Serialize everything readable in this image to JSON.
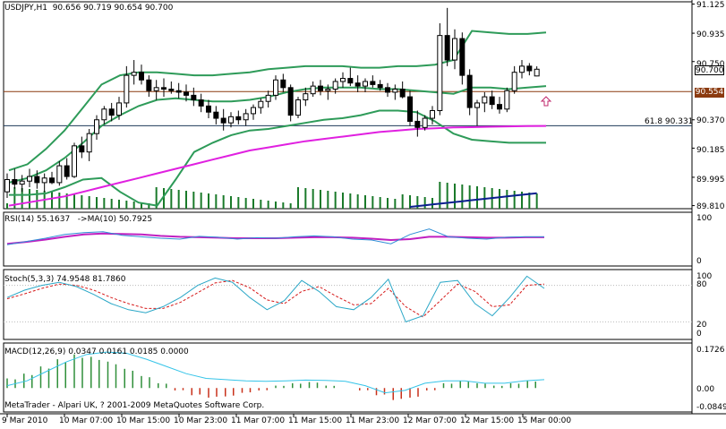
{
  "main": {
    "title": "USDJPY,H1",
    "ohlc": [
      "90.656",
      "90.719",
      "90.654",
      "90.700"
    ],
    "price_ticks": [
      "91.125",
      "90.935",
      "90.750",
      "90.370",
      "90.185",
      "89.995",
      "89.810"
    ],
    "current_price_tag": "90.700",
    "hline_price_tag": "90.554",
    "fib_label": "61.8 90.331",
    "price_range": [
      89.79,
      91.14
    ],
    "colors": {
      "bollinger": "#2e9b59",
      "ma": "#e020e0",
      "hline": "#8b3a0f",
      "fib": "#1f3a5a",
      "volume": "#1a7a2a",
      "obv": "#0b1f8f",
      "arrow": "#c0286c"
    }
  },
  "rsi": {
    "title": "RSI(14) 55.1637",
    "ma_title": "->MA(10) 50.7925",
    "ticks": [
      "100",
      "0"
    ],
    "colors": {
      "rsi": "#2f8fd6",
      "ma": "#c020c0"
    }
  },
  "stoch": {
    "title": "Stoch(5,3,3) 74.9548 81.7860",
    "ticks": [
      "100",
      "80",
      "20",
      "0"
    ],
    "colors": {
      "main": "#2aa7c7",
      "signal": "#d61a1a"
    }
  },
  "macd": {
    "title": "MACD(12,26,9) 0.0347 0.0161 0.0185 0.0000",
    "ticks": [
      "0.1726",
      "0.00",
      "-0.0849"
    ],
    "copyright": "MetaTrader - Alpari UK, ? 2001-2009 MetaQuotes Software Corp.",
    "colors": {
      "line": "#35c4e8",
      "pos": "#2f8f3a",
      "neg": "#c8301a"
    }
  },
  "time_axis": [
    "9 Mar 2010",
    "10 Mar 07:00",
    "10 Mar 15:00",
    "10 Mar 23:00",
    "11 Mar 07:00",
    "11 Mar 15:00",
    "11 Mar 23:00",
    "12 Mar 07:00",
    "12 Mar 15:00",
    "15 Mar 00:00"
  ],
  "chart_data": {
    "type": "line",
    "symbol": "USDJPY",
    "timeframe": "H1",
    "hlines": [
      90.554,
      90.331
    ],
    "candles_ohlc": [
      [
        89.9,
        90.02,
        89.86,
        89.98
      ],
      [
        89.98,
        90.05,
        89.92,
        89.95
      ],
      [
        89.95,
        90.01,
        89.9,
        89.97
      ],
      [
        89.97,
        90.05,
        89.93,
        90.0
      ],
      [
        90.0,
        90.04,
        89.92,
        89.96
      ],
      [
        89.96,
        90.02,
        89.9,
        89.99
      ],
      [
        89.99,
        90.03,
        89.95,
        89.96
      ],
      [
        89.96,
        90.1,
        89.94,
        90.07
      ],
      [
        90.07,
        90.12,
        89.98,
        90.0
      ],
      [
        90.0,
        90.22,
        89.99,
        90.2
      ],
      [
        90.2,
        90.26,
        90.12,
        90.16
      ],
      [
        90.16,
        90.31,
        90.1,
        90.28
      ],
      [
        90.28,
        90.4,
        90.24,
        90.37
      ],
      [
        90.37,
        90.46,
        90.34,
        90.44
      ],
      [
        90.44,
        90.48,
        90.36,
        90.4
      ],
      [
        90.4,
        90.52,
        90.37,
        90.48
      ],
      [
        90.48,
        90.72,
        90.45,
        90.66
      ],
      [
        90.66,
        90.76,
        90.6,
        90.68
      ],
      [
        90.68,
        90.73,
        90.6,
        90.63
      ],
      [
        90.63,
        90.66,
        90.52,
        90.56
      ],
      [
        90.56,
        90.63,
        90.5,
        90.58
      ],
      [
        90.58,
        90.64,
        90.52,
        90.57
      ],
      [
        90.57,
        90.62,
        90.54,
        90.56
      ],
      [
        90.56,
        90.61,
        90.51,
        90.55
      ],
      [
        90.55,
        90.6,
        90.49,
        90.53
      ],
      [
        90.53,
        90.58,
        90.46,
        90.5
      ],
      [
        90.5,
        90.54,
        90.42,
        90.46
      ],
      [
        90.46,
        90.5,
        90.38,
        90.42
      ],
      [
        90.42,
        90.46,
        90.34,
        90.38
      ],
      [
        90.38,
        90.44,
        90.3,
        90.35
      ],
      [
        90.35,
        90.42,
        90.32,
        90.39
      ],
      [
        90.39,
        90.43,
        90.34,
        90.37
      ],
      [
        90.37,
        90.44,
        90.33,
        90.41
      ],
      [
        90.41,
        90.47,
        90.37,
        90.45
      ],
      [
        90.45,
        90.51,
        90.41,
        90.49
      ],
      [
        90.49,
        90.56,
        90.45,
        90.53
      ],
      [
        90.53,
        90.66,
        90.5,
        90.63
      ],
      [
        90.63,
        90.67,
        90.55,
        90.58
      ],
      [
        90.58,
        90.6,
        90.36,
        90.4
      ],
      [
        90.4,
        90.52,
        90.38,
        90.5
      ],
      [
        90.5,
        90.58,
        90.46,
        90.54
      ],
      [
        90.54,
        90.62,
        90.52,
        90.59
      ],
      [
        90.59,
        90.63,
        90.53,
        90.56
      ],
      [
        90.56,
        90.6,
        90.5,
        90.57
      ],
      [
        90.57,
        90.64,
        90.54,
        90.62
      ],
      [
        90.62,
        90.68,
        90.58,
        90.64
      ],
      [
        90.64,
        90.71,
        90.59,
        90.61
      ],
      [
        90.61,
        90.66,
        90.55,
        90.59
      ],
      [
        90.59,
        90.64,
        90.55,
        90.62
      ],
      [
        90.62,
        90.66,
        90.58,
        90.6
      ],
      [
        90.6,
        90.63,
        90.56,
        90.58
      ],
      [
        90.58,
        90.61,
        90.52,
        90.55
      ],
      [
        90.55,
        90.6,
        90.5,
        90.57
      ],
      [
        90.57,
        90.62,
        90.51,
        90.52
      ],
      [
        90.52,
        90.56,
        90.33,
        90.36
      ],
      [
        90.36,
        90.43,
        90.26,
        90.32
      ],
      [
        90.32,
        90.4,
        90.3,
        90.38
      ],
      [
        90.38,
        90.46,
        90.34,
        90.43
      ],
      [
        90.43,
        91.0,
        90.4,
        90.92
      ],
      [
        90.92,
        91.1,
        90.72,
        90.76
      ],
      [
        90.76,
        90.96,
        90.7,
        90.9
      ],
      [
        90.9,
        90.94,
        90.6,
        90.66
      ],
      [
        90.66,
        90.7,
        90.4,
        90.45
      ],
      [
        90.45,
        90.5,
        90.33,
        90.48
      ],
      [
        90.48,
        90.55,
        90.42,
        90.52
      ],
      [
        90.52,
        90.56,
        90.44,
        90.47
      ],
      [
        90.47,
        90.52,
        90.41,
        90.44
      ],
      [
        90.44,
        90.58,
        90.42,
        90.56
      ],
      [
        90.56,
        90.72,
        90.54,
        90.68
      ],
      [
        90.68,
        90.76,
        90.64,
        90.72
      ],
      [
        90.72,
        90.74,
        90.66,
        90.69
      ],
      [
        90.656,
        90.719,
        90.654,
        90.7
      ]
    ],
    "ma_slow": [
      89.81,
      89.83,
      89.85,
      89.87,
      89.9,
      89.93,
      89.96,
      89.99,
      90.02,
      90.05,
      90.08,
      90.11,
      90.14,
      90.17,
      90.19,
      90.21,
      90.23,
      90.245,
      90.26,
      90.275,
      90.29,
      90.3,
      90.31,
      90.315,
      90.32,
      90.322,
      90.325,
      90.327,
      90.329,
      90.33
    ],
    "bb_upper": [
      90.04,
      90.08,
      90.18,
      90.3,
      90.45,
      90.6,
      90.66,
      90.68,
      90.68,
      90.67,
      90.66,
      90.66,
      90.67,
      90.68,
      90.7,
      90.71,
      90.72,
      90.72,
      90.72,
      90.71,
      90.71,
      90.72,
      90.72,
      90.73,
      90.76,
      90.95,
      90.94,
      90.93,
      90.93,
      90.94
    ],
    "bb_mid": [
      89.96,
      89.99,
      90.04,
      90.12,
      90.22,
      90.33,
      90.4,
      90.46,
      90.5,
      90.51,
      90.5,
      90.49,
      90.49,
      90.5,
      90.52,
      90.55,
      90.57,
      90.58,
      90.58,
      90.58,
      90.57,
      90.57,
      90.56,
      90.55,
      90.54,
      90.58,
      90.58,
      90.57,
      90.58,
      90.59
    ],
    "bb_lower": [
      89.88,
      89.88,
      89.89,
      89.93,
      89.98,
      89.99,
      89.9,
      89.83,
      89.81,
      89.98,
      90.16,
      90.22,
      90.27,
      90.3,
      90.31,
      90.33,
      90.35,
      90.37,
      90.38,
      90.4,
      90.43,
      90.43,
      90.42,
      90.36,
      90.28,
      90.24,
      90.23,
      90.22,
      90.22,
      90.22
    ],
    "rsi": [
      38,
      45,
      52,
      60,
      64,
      66,
      58,
      55,
      52,
      50,
      56,
      54,
      50,
      53,
      52,
      55,
      57,
      55,
      50,
      48,
      40,
      60,
      72,
      55,
      52,
      50,
      54,
      55,
      55
    ],
    "rsi_ma": [
      40,
      44,
      49,
      55,
      60,
      62,
      61,
      60,
      57,
      55,
      54,
      53,
      52,
      52,
      52,
      53,
      54,
      54,
      53,
      51,
      48,
      50,
      55,
      55,
      54,
      53,
      53,
      54,
      54
    ],
    "stoch_main": [
      60,
      72,
      80,
      85,
      78,
      65,
      50,
      40,
      35,
      45,
      60,
      80,
      92,
      85,
      60,
      40,
      55,
      88,
      70,
      45,
      40,
      60,
      90,
      20,
      30,
      85,
      88,
      50,
      30,
      60,
      95,
      75
    ],
    "stoch_signal": [
      58,
      66,
      75,
      82,
      80,
      72,
      60,
      50,
      42,
      42,
      52,
      68,
      84,
      88,
      76,
      56,
      50,
      70,
      78,
      62,
      48,
      50,
      75,
      45,
      28,
      55,
      82,
      70,
      45,
      48,
      80,
      82
    ],
    "macd": [
      0.01,
      0.03,
      0.07,
      0.11,
      0.14,
      0.15,
      0.145,
      0.12,
      0.09,
      0.06,
      0.04,
      0.035,
      0.03,
      0.028,
      0.03,
      0.033,
      0.032,
      0.028,
      0.01,
      -0.02,
      -0.01,
      0.02,
      0.03,
      0.03,
      0.02,
      0.02,
      0.03,
      0.035
    ],
    "macd_hist": [
      0.04,
      0.06,
      0.09,
      0.12,
      0.14,
      0.13,
      0.11,
      0.08,
      0.05,
      0.02,
      -0.01,
      -0.03,
      -0.04,
      -0.035,
      -0.02,
      -0.01,
      0.01,
      0.02,
      0.025,
      0.01,
      0.0,
      -0.01,
      -0.03,
      -0.05,
      -0.04,
      -0.01,
      0.02,
      0.03,
      0.02,
      0.01,
      0.02,
      0.03
    ]
  }
}
